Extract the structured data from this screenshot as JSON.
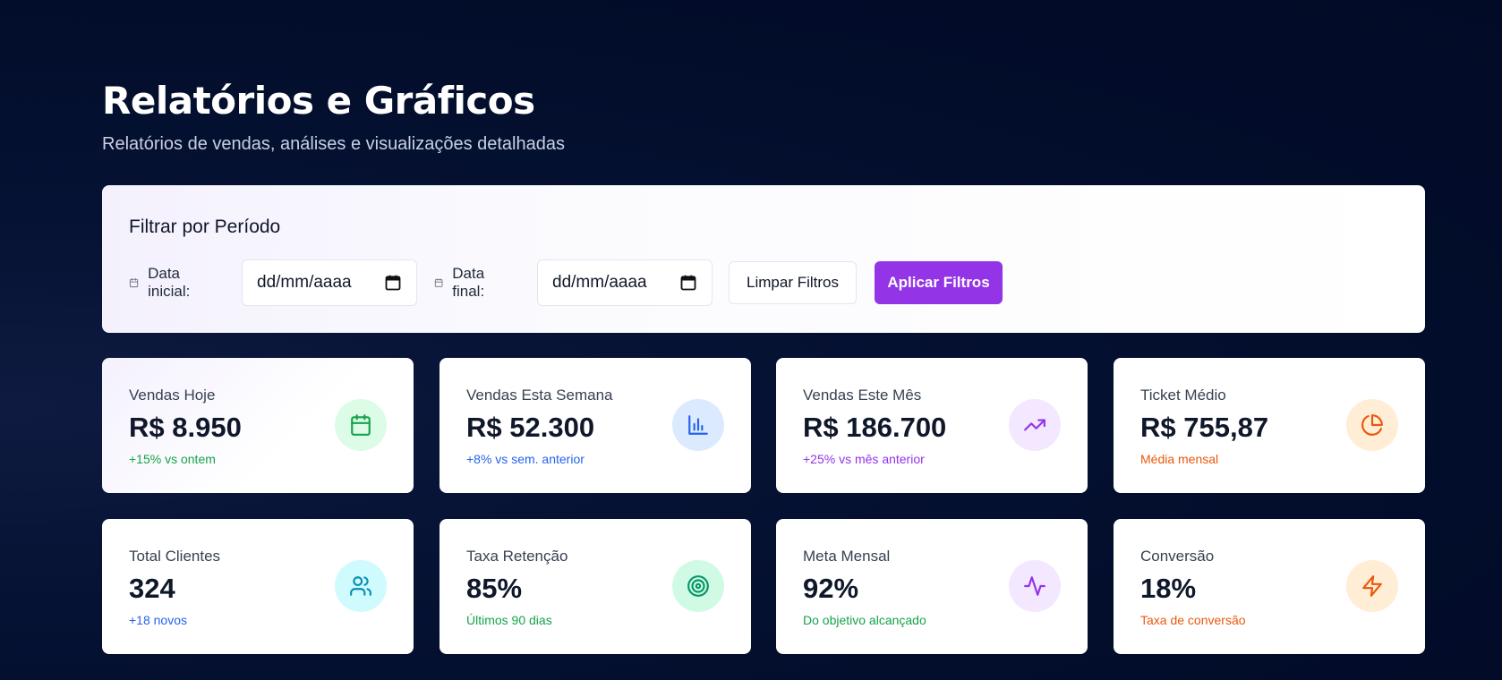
{
  "header": {
    "title": "Relatórios e Gráficos",
    "subtitle": "Relatórios de vendas, análises e visualizações detalhadas"
  },
  "filter": {
    "title": "Filtrar por Período",
    "start_label": "Data inicial:",
    "start_placeholder": "dd/mm/aaaa",
    "end_label": "Data final:",
    "end_placeholder": "dd/mm/aaaa",
    "clear_label": "Limpar Filtros",
    "apply_label": "Aplicar Filtros",
    "apply_color": "#9334e6"
  },
  "stats": [
    {
      "label": "Vendas Hoje",
      "value": "R$ 8.950",
      "note": "+15% vs ontem",
      "note_color": "#16a34a",
      "icon": "calendar-icon",
      "icon_bg": "#dcfce7",
      "icon_color": "#16a34a"
    },
    {
      "label": "Vendas Esta Semana",
      "value": "R$ 52.300",
      "note": "+8% vs sem. anterior",
      "note_color": "#2563eb",
      "icon": "bar-chart-icon",
      "icon_bg": "#dbeafe",
      "icon_color": "#2563eb"
    },
    {
      "label": "Vendas Este Mês",
      "value": "R$ 186.700",
      "note": "+25% vs mês anterior",
      "note_color": "#9333ea",
      "icon": "trending-up-icon",
      "icon_bg": "#f3e8ff",
      "icon_color": "#9333ea"
    },
    {
      "label": "Ticket Médio",
      "value": "R$ 755,87",
      "note": "Média mensal",
      "note_color": "#ea580c",
      "icon": "pie-chart-icon",
      "icon_bg": "#ffedd5",
      "icon_color": "#ea580c"
    },
    {
      "label": "Total Clientes",
      "value": "324",
      "note": "+18 novos",
      "note_color": "#2563eb",
      "icon": "users-icon",
      "icon_bg": "#cffafe",
      "icon_color": "#0891b2"
    },
    {
      "label": "Taxa Retenção",
      "value": "85%",
      "note": "Últimos 90 dias",
      "note_color": "#16a34a",
      "icon": "target-icon",
      "icon_bg": "#d1fae5",
      "icon_color": "#059669"
    },
    {
      "label": "Meta Mensal",
      "value": "92%",
      "note": "Do objetivo alcançado",
      "note_color": "#16a34a",
      "icon": "activity-icon",
      "icon_bg": "#f3e8ff",
      "icon_color": "#9333ea"
    },
    {
      "label": "Conversão",
      "value": "18%",
      "note": "Taxa de conversão",
      "note_color": "#ea580c",
      "icon": "zap-icon",
      "icon_bg": "#ffedd5",
      "icon_color": "#ea580c"
    }
  ]
}
